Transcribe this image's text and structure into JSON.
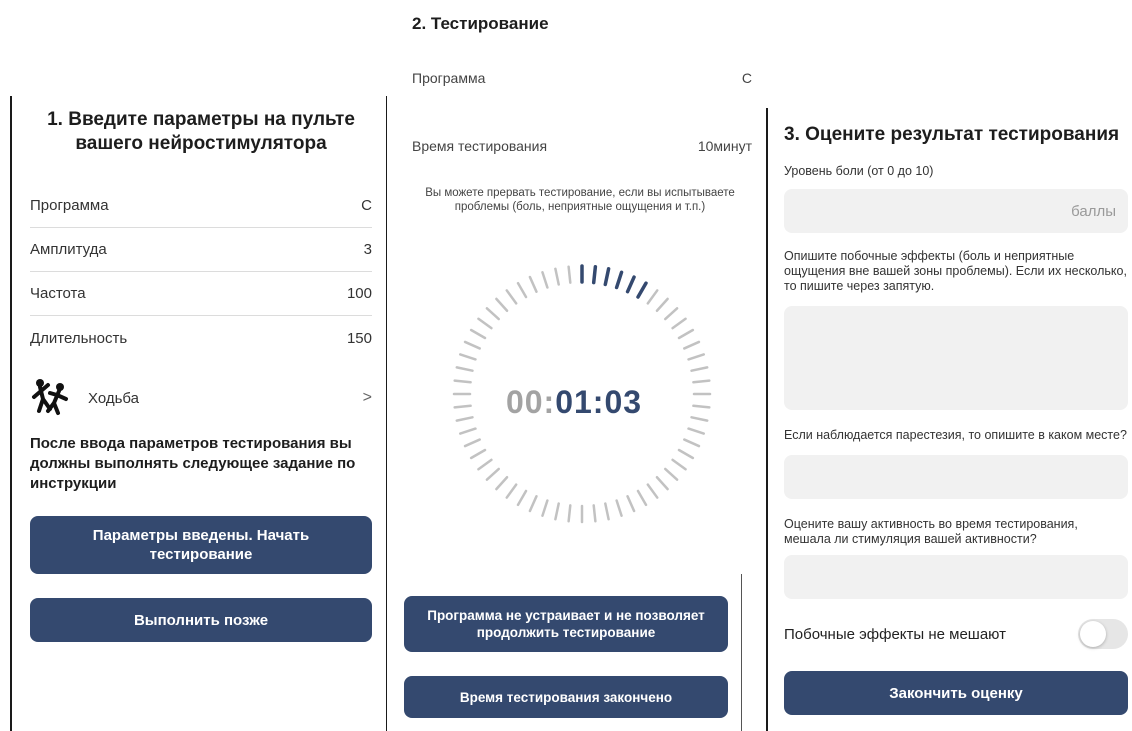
{
  "step1": {
    "title": "1. Введите параметры на пульте вашего нейростимулятора",
    "params": [
      {
        "label": "Программа",
        "value": "С"
      },
      {
        "label": "Амплитуда",
        "value": "3"
      },
      {
        "label": "Частота",
        "value": "100"
      },
      {
        "label": "Длительность",
        "value": "150"
      }
    ],
    "activity": {
      "label": "Ходьба",
      "icon": "walking-figure-icon",
      "chevron": ">"
    },
    "note": "После ввода параметров тестирования вы должны выполнять следующее задание по инструкции",
    "start_button": "Параметры введены. Начать тестирование",
    "later_button": "Выполнить позже"
  },
  "step2": {
    "title": "2. Тестирование",
    "program_label": "Программа",
    "program_value": "С",
    "time_label": "Время тестирования",
    "time_value": "10минут",
    "note": "Вы можете прервать тестирование, если вы испытываете проблемы (боль, неприятные ощущения и т.п.)",
    "timer_prefix": "00:",
    "timer_value": "01:03",
    "dial": {
      "total_ticks": 60,
      "active_ticks": 6
    },
    "reject_button": "Программа не устраивает и не позволяет продолжить тестирование",
    "finished_button": "Время тестирования закончено"
  },
  "step3": {
    "title": "3. Оцените результат тестирования",
    "pain_label": "Уровень боли (от 0 до 10)",
    "pain_placeholder": "баллы",
    "side_effects_label": "Опишите побочные эффекты (боль и неприятные ощущения вне вашей зоны проблемы). Если их несколько, то пишите через запятую.",
    "paresthesia_label": "Если наблюдается парестезия, то опишите в каком месте?",
    "activity_label": "Оцените вашу активность во время тестирования, мешала ли стимуляция вашей активности?",
    "toggle_label": "Побочные эффекты не мешают",
    "toggle_on": false,
    "finish_button": "Закончить оценку"
  },
  "colors": {
    "accent": "#34496f",
    "tick_inactive": "#c2c2c2",
    "input_bg": "#f1f1f1"
  }
}
